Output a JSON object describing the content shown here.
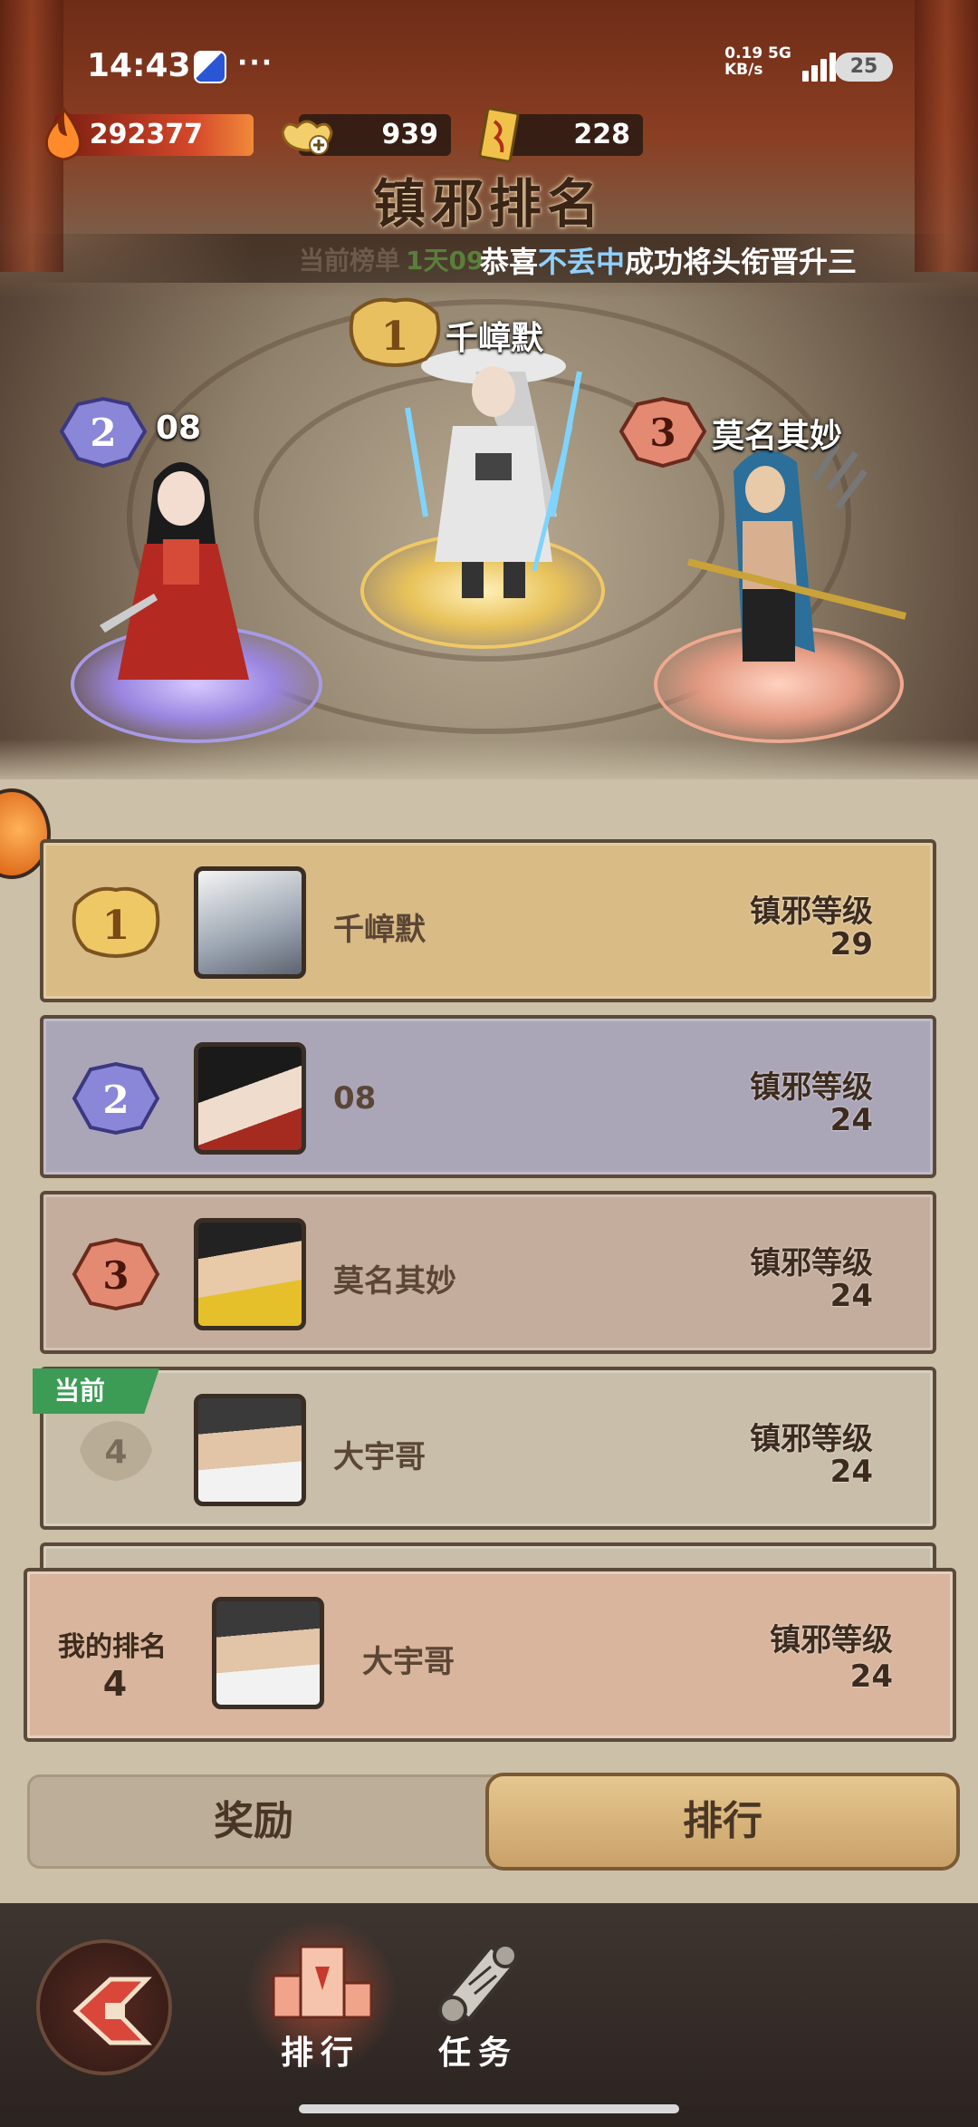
{
  "status_bar": {
    "time": "14:43",
    "more": "···",
    "net_speed": "0.19",
    "net_unit": "KB/s",
    "net_type": "5G",
    "battery": "25"
  },
  "currency": {
    "power": "292377",
    "ingot": "939",
    "ticket": "228"
  },
  "title": "镇邪排名",
  "ticker": {
    "prefix": "当前榜单",
    "countdown": "1天09",
    "msg_start": "恭喜",
    "msg_name": "不丢中",
    "msg_end": "成功将头衔晋升三"
  },
  "podium": {
    "first": {
      "rank": "1",
      "name": "千嶂默"
    },
    "second": {
      "rank": "2",
      "name": "08"
    },
    "third": {
      "rank": "3",
      "name": "莫名其妙"
    }
  },
  "level_label": "镇邪等级",
  "rankings": [
    {
      "rank": "1",
      "name": "千嶂默",
      "level": "29"
    },
    {
      "rank": "2",
      "name": "08",
      "level": "24"
    },
    {
      "rank": "3",
      "name": "莫名其妙",
      "level": "24"
    },
    {
      "rank": "4",
      "name": "大宇哥",
      "level": "24"
    }
  ],
  "current_tag": "当前",
  "my_rank": {
    "label": "我的排名",
    "rank": "4",
    "name": "大宇哥",
    "level_label": "镇邪等级",
    "level": "24"
  },
  "tabs": {
    "reward": "奖励",
    "ranking": "排行"
  },
  "nav": {
    "rank": "排行",
    "task": "任务"
  },
  "colors": {
    "gold": "#d9b56a",
    "silver": "#7a76c0",
    "bronze": "#d07a62",
    "highlight": "#8fd0ff"
  }
}
